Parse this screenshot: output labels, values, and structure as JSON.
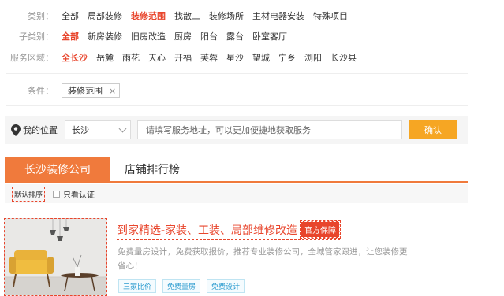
{
  "filters": {
    "type": {
      "label": "类别：",
      "options": [
        "全部",
        "局部装修",
        "装修范围",
        "找散工",
        "装修场所",
        "主材电器安装",
        "特殊项目"
      ],
      "selected_index": 2
    },
    "subtype": {
      "label": "子类别：",
      "options": [
        "全部",
        "新房装修",
        "旧房改造",
        "厨房",
        "阳台",
        "露台",
        "卧室客厅"
      ],
      "selected_index": 0
    },
    "area": {
      "label": "服务区域：",
      "options": [
        "全长沙",
        "岳麓",
        "雨花",
        "天心",
        "开福",
        "芙蓉",
        "星沙",
        "望城",
        "宁乡",
        "浏阳",
        "长沙县"
      ],
      "selected_index": 0
    },
    "condition": {
      "label": "条件：",
      "tag": "装修范围",
      "remove": "×"
    }
  },
  "location": {
    "label": "我的位置",
    "city": "长沙",
    "address_placeholder": "请填写服务地址，可以更加便捷地获取服务",
    "confirm_label": "确认"
  },
  "tabs": [
    {
      "label": "长沙装修公司",
      "active": true
    },
    {
      "label": "店铺排行榜",
      "active": false
    }
  ],
  "sort": {
    "default_label": "默认排序",
    "verified_label": "只看认证"
  },
  "listing": {
    "title": "到家精选-家装、工装、局部维修改造",
    "badge": "官方保障",
    "description": "免费量房设计，免费获取报价，推荐专业装修公司，全城管家跟进，让您装修更省心！",
    "tags": [
      "三家比价",
      "免费量房",
      "免费设计"
    ]
  },
  "colors": {
    "accent_red": "#e8452c",
    "tab_orange": "#f07a3c",
    "button_orange": "#f6a623",
    "tag_blue": "#2b9bcf"
  }
}
